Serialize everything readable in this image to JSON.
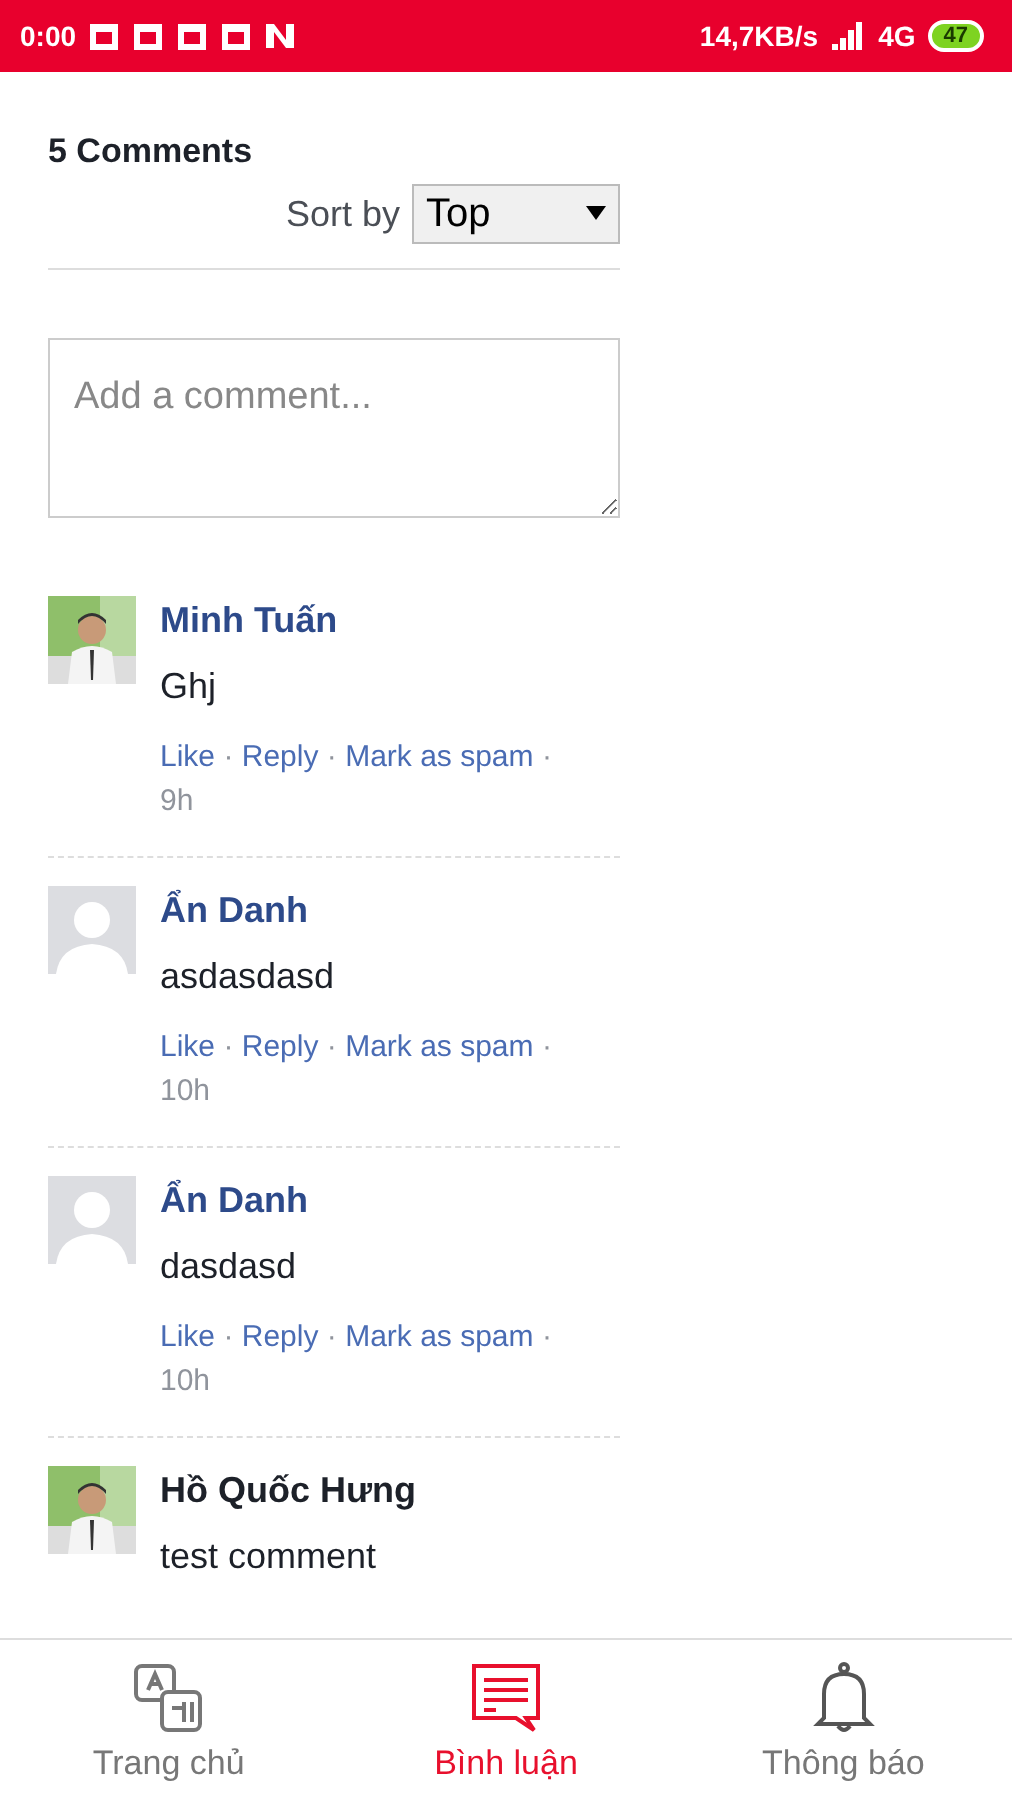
{
  "status_bar": {
    "time": "0:00",
    "speed": "14,7KB/s",
    "network": "4G",
    "battery": "47"
  },
  "comments_header": {
    "count": "5 Comments",
    "sort_label": "Sort by",
    "sort_value": "Top"
  },
  "composer": {
    "placeholder": "Add a comment..."
  },
  "comments": [
    {
      "author": "Minh Tuấn",
      "linked": true,
      "text": "Ghj",
      "actions": [
        "Like",
        "Reply",
        "Mark as spam"
      ],
      "separator": "·",
      "time": "9h"
    },
    {
      "author": "Ẩn Danh",
      "linked": true,
      "kind": "placeholder",
      "text": "asdasdasd",
      "actions": [
        "Like",
        "Reply",
        "Mark as spam"
      ],
      "separator": "·",
      "time": "10h"
    },
    {
      "author": "Ẩn Danh",
      "linked": true,
      "kind": "placeholder",
      "text": "dasdasd",
      "actions": [
        "Like",
        "Reply",
        "Mark as spam"
      ],
      "separator": "·",
      "time": "10h"
    },
    {
      "author": "Hồ Quốc Hưng",
      "linked": false,
      "text": "test comment"
    }
  ],
  "nav": [
    {
      "label": "Trang chủ",
      "kind": "translate",
      "selected": false
    },
    {
      "label": "Bình luận",
      "kind": "comment",
      "selected": true
    },
    {
      "label": "Thông báo",
      "kind": "bell",
      "selected": false
    }
  ]
}
